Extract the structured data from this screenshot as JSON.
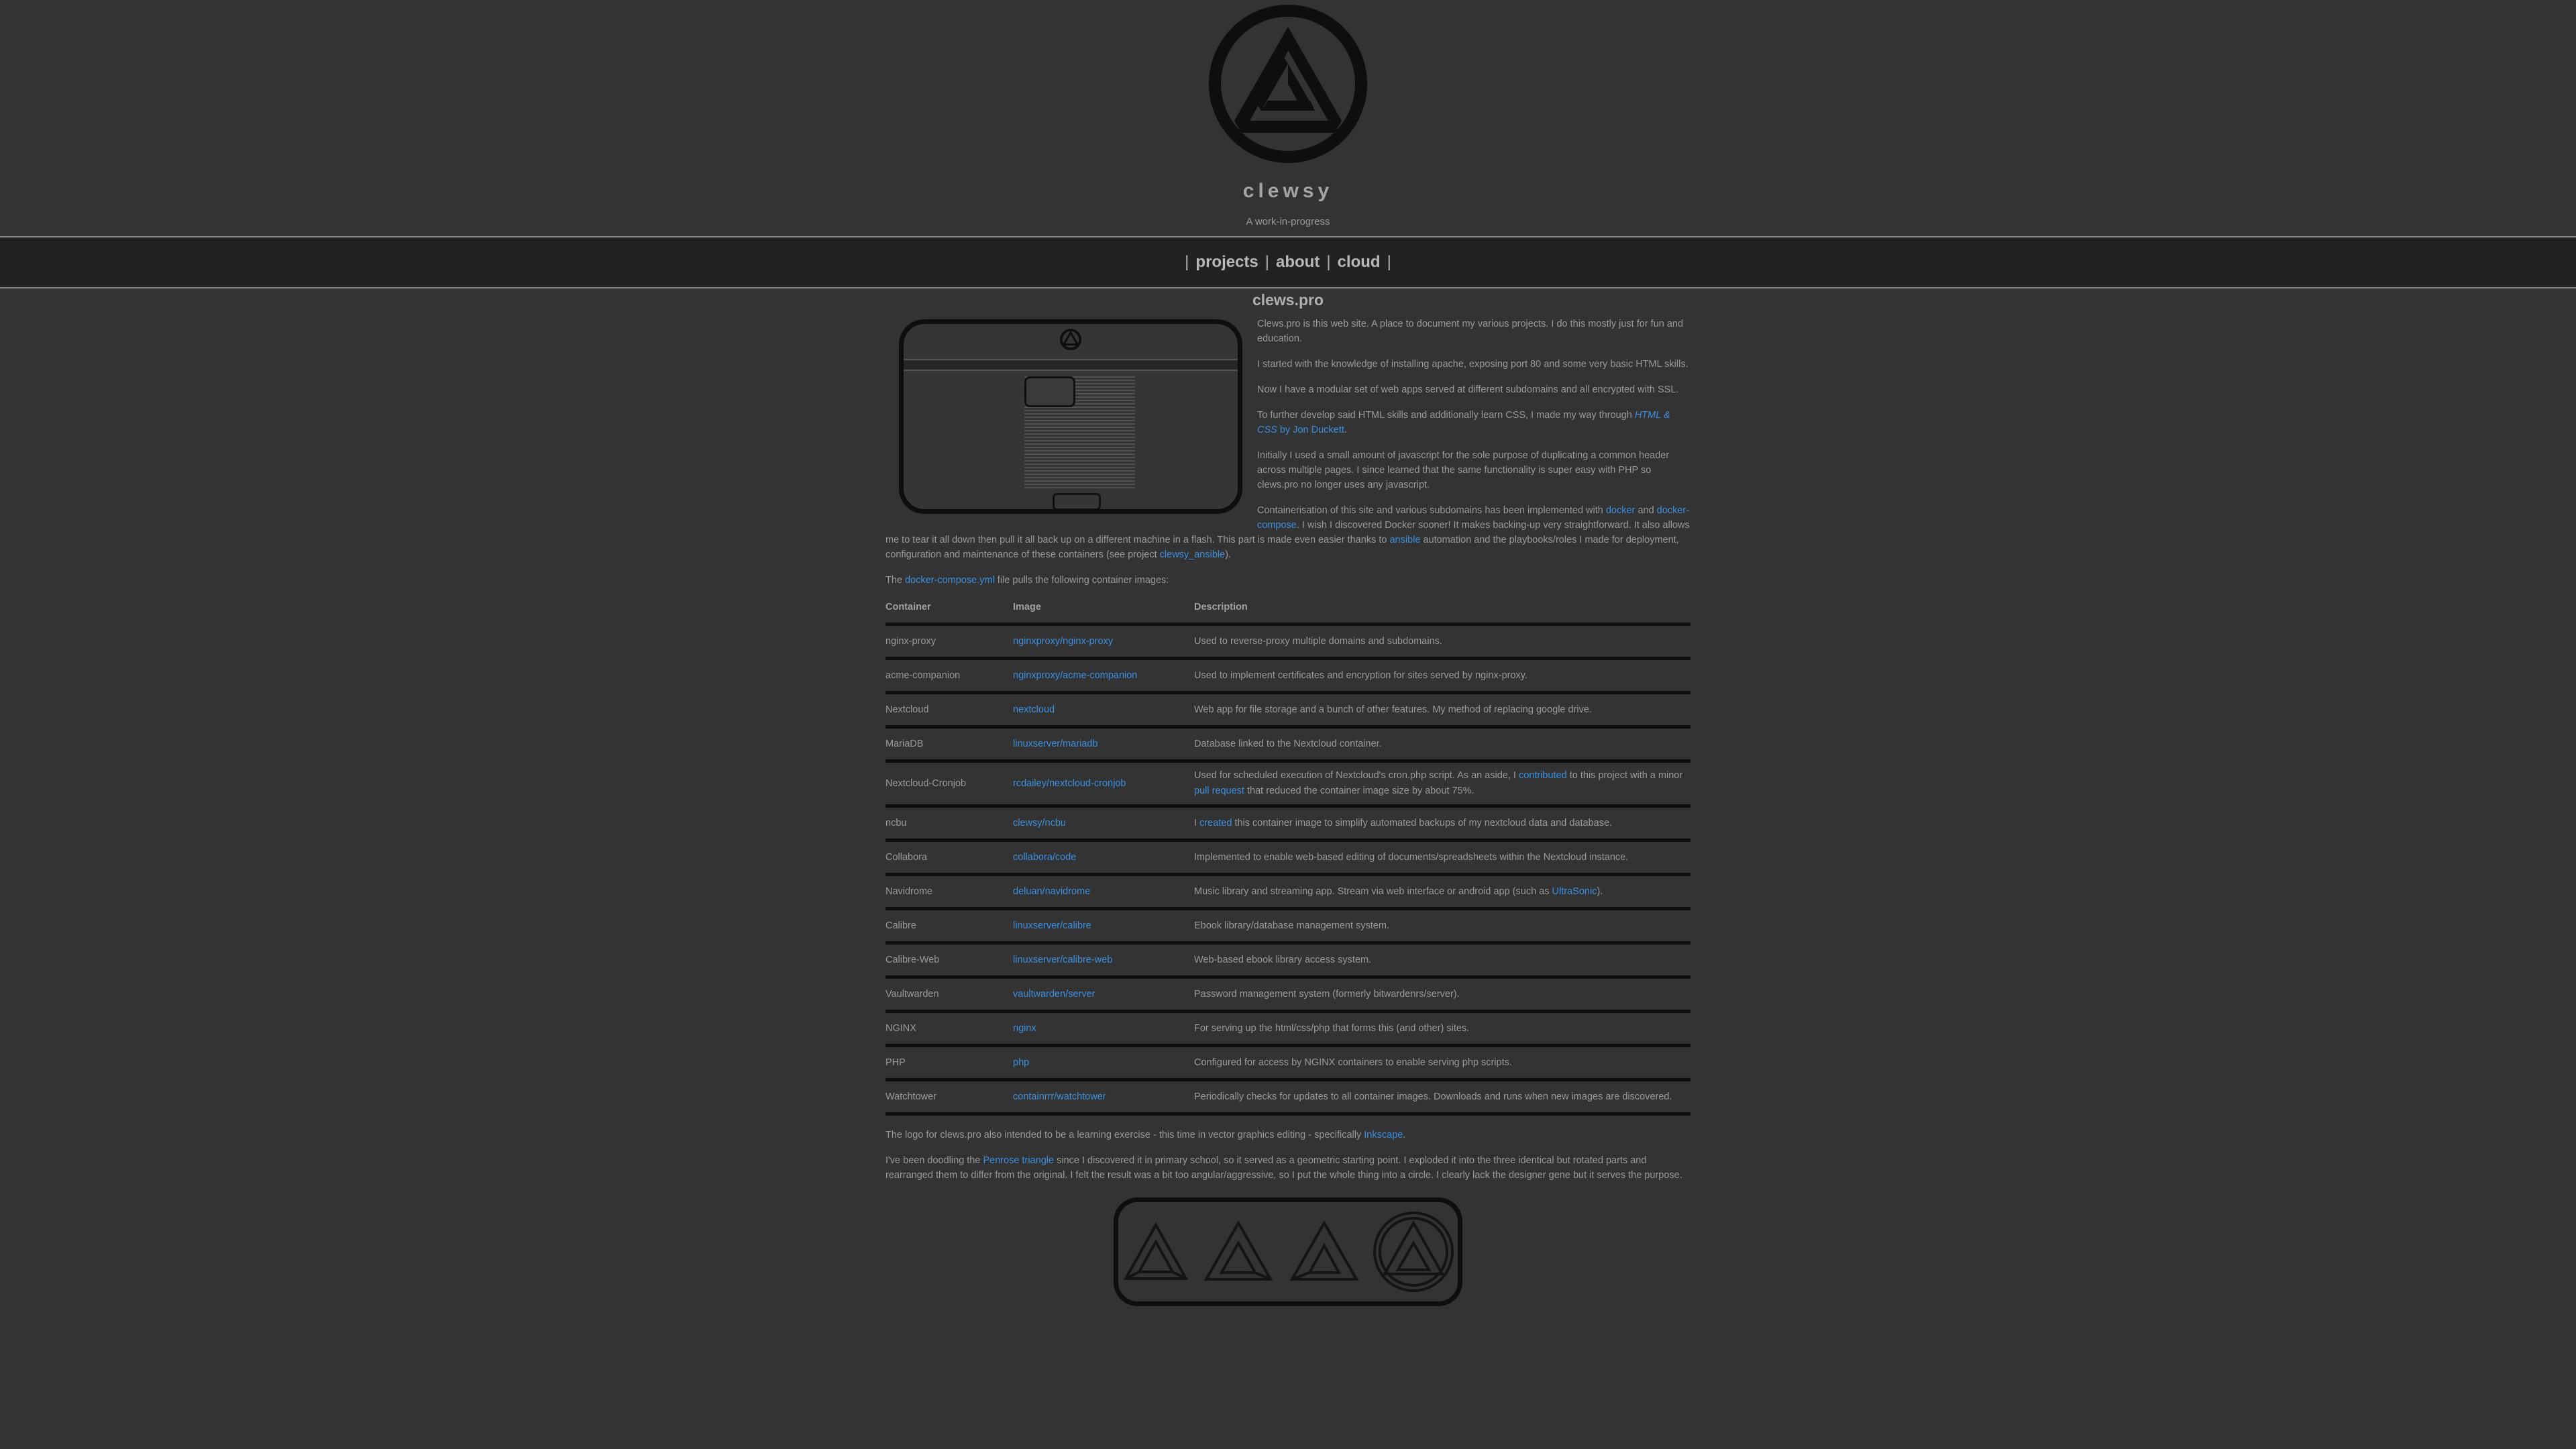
{
  "site": {
    "title": "clewsy",
    "tagline": "A work-in-progress"
  },
  "nav": {
    "sep": "|",
    "items": [
      {
        "label": "projects"
      },
      {
        "label": "about"
      },
      {
        "label": "cloud"
      }
    ]
  },
  "page": {
    "title": "clews.pro",
    "intro": [
      "Clews.pro is this web site. A place to document my various projects. I do this mostly just for fun and education.",
      "I started with the knowledge of installing apache, exposing port 80 and some very basic HTML skills.",
      "Now I have a modular set of web apps served at different subdomains and all encrypted with SSL."
    ],
    "p4": {
      "text": "To further develop said HTML skills and additionally learn CSS, I made my way through ",
      "link1": "HTML & CSS",
      "mid": " by ",
      "link2": "Jon Duckett",
      "end": "."
    },
    "p5": "Initially I used a small amount of javascript for the sole purpose of duplicating a common header across multiple pages. I since learned that the same functionality is super easy with PHP so clews.pro no longer uses any javascript.",
    "p6": {
      "t1": "Containerisation of this site and various subdomains has been implemented with ",
      "l1": "docker",
      "t2": " and ",
      "l2": "docker-compose",
      "t3": ". I wish I discovered Docker sooner! It makes backing-up very straightforward. It also allows me to tear it all down then pull it all back up on a different machine in a flash. This part is made even easier thanks to ",
      "l3": "ansible",
      "t4": " automation and the playbooks/roles I made for deployment, configuration and maintenance of these containers (see project ",
      "l4": "clewsy_ansible",
      "t5": ")."
    },
    "p7": {
      "t1": "The ",
      "l1": "docker-compose.yml",
      "t2": " file pulls the following container images:"
    }
  },
  "table": {
    "headers": {
      "container": "Container",
      "image": "Image",
      "description": "Description"
    },
    "rows": [
      {
        "container": "nginx-proxy",
        "image": "nginxproxy/nginx-proxy",
        "description": "Used to reverse-proxy multiple domains and subdomains."
      },
      {
        "container": "acme-companion",
        "image": "nginxproxy/acme-companion",
        "description": "Used to implement certificates and encryption for sites served by nginx-proxy."
      },
      {
        "container": "Nextcloud",
        "image": "nextcloud",
        "description": "Web app for file storage and a bunch of other features. My method of replacing google drive."
      },
      {
        "container": "MariaDB",
        "image": "linuxserver/mariadb",
        "description": "Database linked to the Nextcloud container."
      },
      {
        "container": "Nextcloud-Cronjob",
        "image": "rcdailey/nextcloud-cronjob",
        "d1": "Used for scheduled execution of Nextcloud's cron.php script. As an aside, I ",
        "dl1": "contributed",
        "d2": " to this project with a minor ",
        "dl2": "pull request",
        "d3": " that reduced the container image size by about 75%."
      },
      {
        "container": "ncbu",
        "image": "clewsy/ncbu",
        "d1": "I ",
        "dl1": "created",
        "d2": " this container image to simplify automated backups of my nextcloud data and database."
      },
      {
        "container": "Collabora",
        "image": "collabora/code",
        "description": "Implemented to enable web-based editing of documents/spreadsheets within the Nextcloud instance."
      },
      {
        "container": "Navidrome",
        "image": "deluan/navidrome",
        "d1": "Music library and streaming app. Stream via web interface or android app (such as ",
        "dl1": "UltraSonic",
        "d2": ")."
      },
      {
        "container": "Calibre",
        "image": "linuxserver/calibre",
        "description": "Ebook library/database management system."
      },
      {
        "container": "Calibre-Web",
        "image": "linuxserver/calibre-web",
        "description": "Web-based ebook library access system."
      },
      {
        "container": "Vaultwarden",
        "image": "vaultwarden/server",
        "description": "Password management system (formerly bitwardenrs/server)."
      },
      {
        "container": "NGINX",
        "image": "nginx",
        "description": "For serving up the html/css/php that forms this (and other) sites."
      },
      {
        "container": "PHP",
        "image": "php",
        "description": "Configured for access by NGINX containers to enable serving php scripts."
      },
      {
        "container": "Watchtower",
        "image": "containrrr/watchtower",
        "description": "Periodically checks for updates to all container images. Downloads and runs when new images are discovered."
      }
    ]
  },
  "outro": {
    "p1": {
      "t1": "The logo for clews.pro also intended to be a learning exercise - this time in vector graphics editing - specifically ",
      "l1": "Inkscape",
      "t2": "."
    },
    "p2": {
      "t1": "I've been doodling the ",
      "l1": "Penrose triangle",
      "t2": " since I discovered it in primary school, so it served as a geometric starting point. I exploded it into the three identical but rotated parts and rearranged them to differ from the original. I felt the result was a bit too angular/aggressive, so I put the whole thing into a circle. I clearly lack the designer gene but it serves the purpose."
    }
  },
  "colors": {
    "background": "#333333",
    "link": "#3d8fe0",
    "nav_bg": "#222222",
    "frame": "#0e0e0e"
  },
  "icons": {
    "logo": "penrose-circle-logo"
  }
}
